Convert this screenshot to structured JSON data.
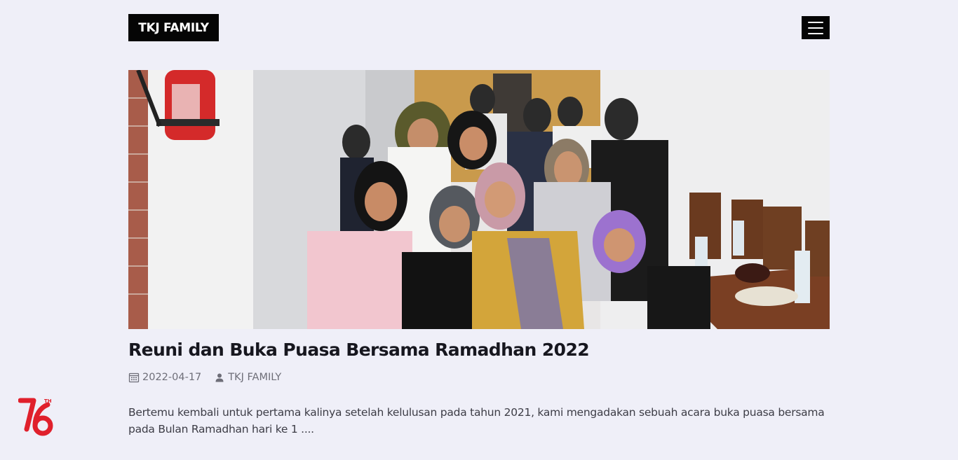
{
  "header": {
    "logo_text": "TKJ FAMILY",
    "menu_icon": "hamburger-icon"
  },
  "post": {
    "image_alt": "Reuni dan Buka Puasa Bersama Ramadhan 2022",
    "title": "Reuni dan Buka Puasa Bersama Ramadhan 2022",
    "date": "2022-04-17",
    "author": "TKJ FAMILY",
    "date_icon": "calendar-icon",
    "author_icon": "user-icon",
    "excerpt": "Bertemu kembali untuk pertama kalinya setelah kelulusan pada tahun 2021, kami mengadakan sebuah acara buka puasa bersama pada Bulan Ramadhan hari ke 1 ...."
  },
  "badge": {
    "number": "76",
    "suffix": "TH",
    "color": "#e0202c"
  },
  "colors": {
    "background": "#efeff8",
    "logo_bg": "#050505",
    "title": "#17171f",
    "meta": "#6e6e78",
    "excerpt": "#3d3d46"
  }
}
